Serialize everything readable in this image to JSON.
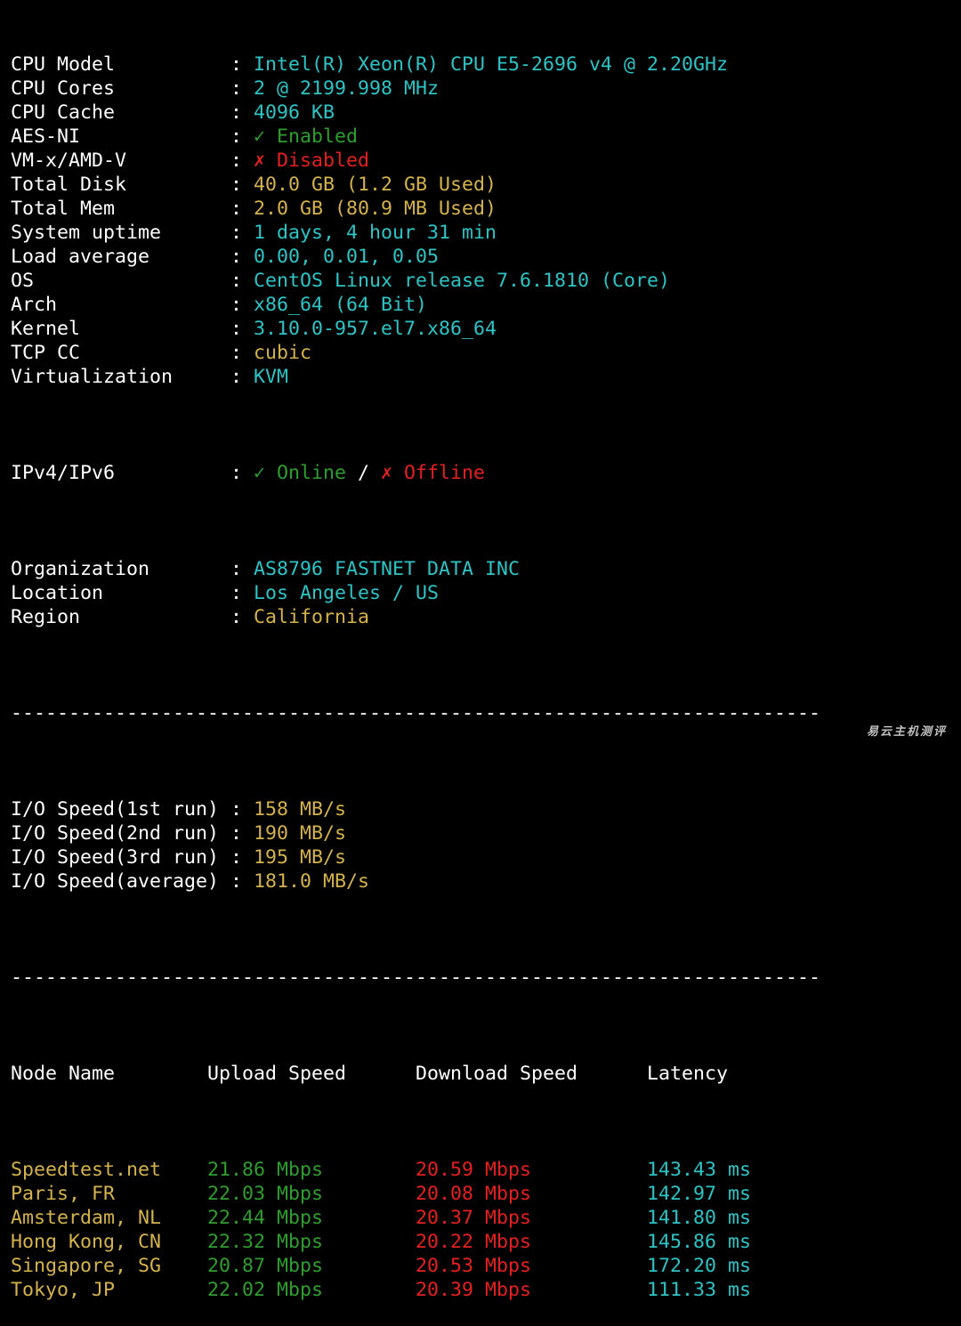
{
  "colors": {
    "cyan": "#2ec4c6",
    "yellow": "#d4b24c",
    "green": "#2f9e2f",
    "red": "#e52020",
    "background": "#000000",
    "text": "#ffffff"
  },
  "sysinfo": [
    {
      "label": "CPU Model",
      "value": "Intel(R) Xeon(R) CPU E5-2696 v4 @ 2.20GHz",
      "color": "cyan"
    },
    {
      "label": "CPU Cores",
      "value": "2 @ 2199.998 MHz",
      "color": "cyan"
    },
    {
      "label": "CPU Cache",
      "value": "4096 KB",
      "color": "cyan"
    },
    {
      "label": "AES-NI",
      "value": "✓ Enabled",
      "color": "green"
    },
    {
      "label": "VM-x/AMD-V",
      "value": "✗ Disabled",
      "color": "red"
    },
    {
      "label": "Total Disk",
      "value": "40.0 GB (1.2 GB Used)",
      "color": "yellow"
    },
    {
      "label": "Total Mem",
      "value": "2.0 GB (80.9 MB Used)",
      "color": "yellow"
    },
    {
      "label": "System uptime",
      "value": "1 days, 4 hour 31 min",
      "color": "cyan"
    },
    {
      "label": "Load average",
      "value": "0.00, 0.01, 0.05",
      "color": "cyan"
    },
    {
      "label": "OS",
      "value": "CentOS Linux release 7.6.1810 (Core)",
      "color": "cyan"
    },
    {
      "label": "Arch",
      "value": "x86_64 (64 Bit)",
      "color": "cyan"
    },
    {
      "label": "Kernel",
      "value": "3.10.0-957.el7.x86_64",
      "color": "cyan"
    },
    {
      "label": "TCP CC",
      "value": "cubic",
      "color": "yellow"
    },
    {
      "label": "Virtualization",
      "value": "KVM",
      "color": "cyan"
    }
  ],
  "network": {
    "label": "IPv4/IPv6",
    "ipv4": "✓ Online",
    "slash": " / ",
    "ipv6": "✗ Offline"
  },
  "sysinfo2": [
    {
      "label": "Organization",
      "value": "AS8796 FASTNET DATA INC",
      "color": "cyan"
    },
    {
      "label": "Location",
      "value": "Los Angeles / US",
      "color": "cyan"
    },
    {
      "label": "Region",
      "value": "California",
      "color": "yellow"
    }
  ],
  "separator": ":",
  "divider": "----------------------------------------------------------------------",
  "io": [
    {
      "label": "I/O Speed(1st run)",
      "value": "158 MB/s"
    },
    {
      "label": "I/O Speed(2nd run)",
      "value": "190 MB/s"
    },
    {
      "label": "I/O Speed(3rd run)",
      "value": "195 MB/s"
    },
    {
      "label": "I/O Speed(average)",
      "value": "181.0 MB/s"
    }
  ],
  "speedtest": {
    "headers": {
      "node": "Node Name",
      "upload": "Upload Speed",
      "download": "Download Speed",
      "latency": "Latency"
    },
    "rows": [
      {
        "node": "Speedtest.net",
        "upload": "21.86 Mbps",
        "download": "20.59 Mbps",
        "latency": "143.43 ms"
      },
      {
        "node": "Paris, FR",
        "upload": "22.03 Mbps",
        "download": "20.08 Mbps",
        "latency": "142.97 ms"
      },
      {
        "node": "Amsterdam, NL",
        "upload": "22.44 Mbps",
        "download": "20.37 Mbps",
        "latency": "141.80 ms"
      },
      {
        "node": "Hong Kong, CN",
        "upload": "22.32 Mbps",
        "download": "20.22 Mbps",
        "latency": "145.86 ms"
      },
      {
        "node": "Singapore, SG",
        "upload": "20.87 Mbps",
        "download": "20.53 Mbps",
        "latency": "172.20 ms"
      },
      {
        "node": "Tokyo, JP",
        "upload": "22.02 Mbps",
        "download": "20.39 Mbps",
        "latency": "111.33 ms"
      }
    ]
  },
  "watermark": "易云主机测评"
}
